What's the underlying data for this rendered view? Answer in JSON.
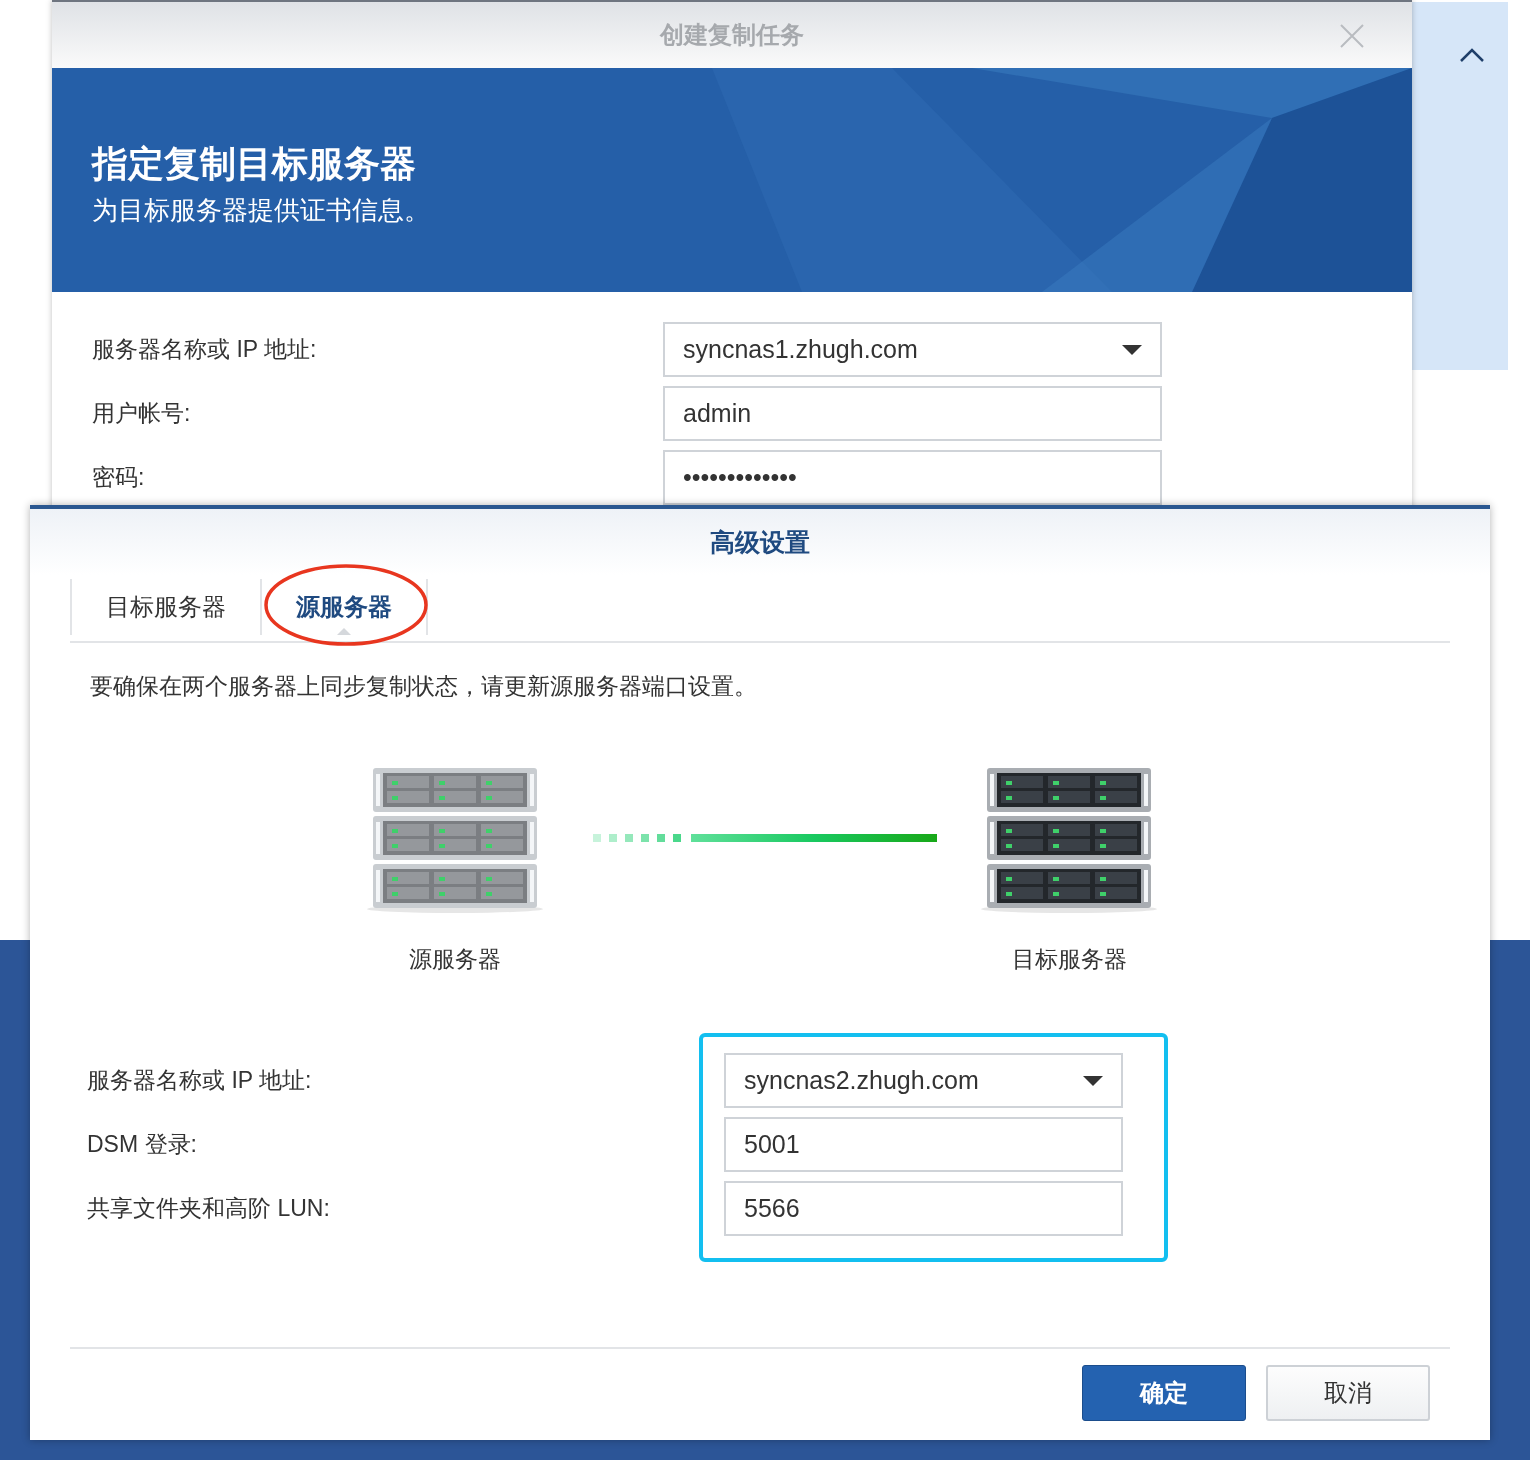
{
  "back_dialog": {
    "title": "创建复制任务",
    "banner": {
      "heading": "指定复制目标服务器",
      "subtitle": "为目标服务器提供证书信息。"
    },
    "fields": [
      {
        "label": "服务器名称或 IP 地址:",
        "value": "syncnas1.zhugh.com",
        "kind": "dropdown"
      },
      {
        "label": "用户帐号:",
        "value": "admin",
        "kind": "text"
      },
      {
        "label": "密码:",
        "value": "•••••••••••••",
        "kind": "password"
      }
    ]
  },
  "dialog": {
    "title": "高级设置",
    "tabs": [
      {
        "label": "目标服务器",
        "selected": false
      },
      {
        "label": "源服务器",
        "selected": true
      }
    ],
    "description": "要确保在两个服务器上同步复制状态，请更新源服务器端口设置。",
    "servers": [
      {
        "label": "源服务器",
        "kind": "light"
      },
      {
        "label": "目标服务器",
        "kind": "dark"
      }
    ],
    "fields": [
      {
        "label": "服务器名称或 IP 地址:",
        "value": "syncnas2.zhugh.com",
        "kind": "dropdown"
      },
      {
        "label": "DSM 登录:",
        "value": "5001",
        "kind": "text"
      },
      {
        "label": "共享文件夹和高阶 LUN:",
        "value": "5566",
        "kind": "text"
      }
    ],
    "buttons": [
      {
        "label": "确定",
        "kind": "primary"
      },
      {
        "label": "取消",
        "kind": "secondary"
      }
    ]
  }
}
